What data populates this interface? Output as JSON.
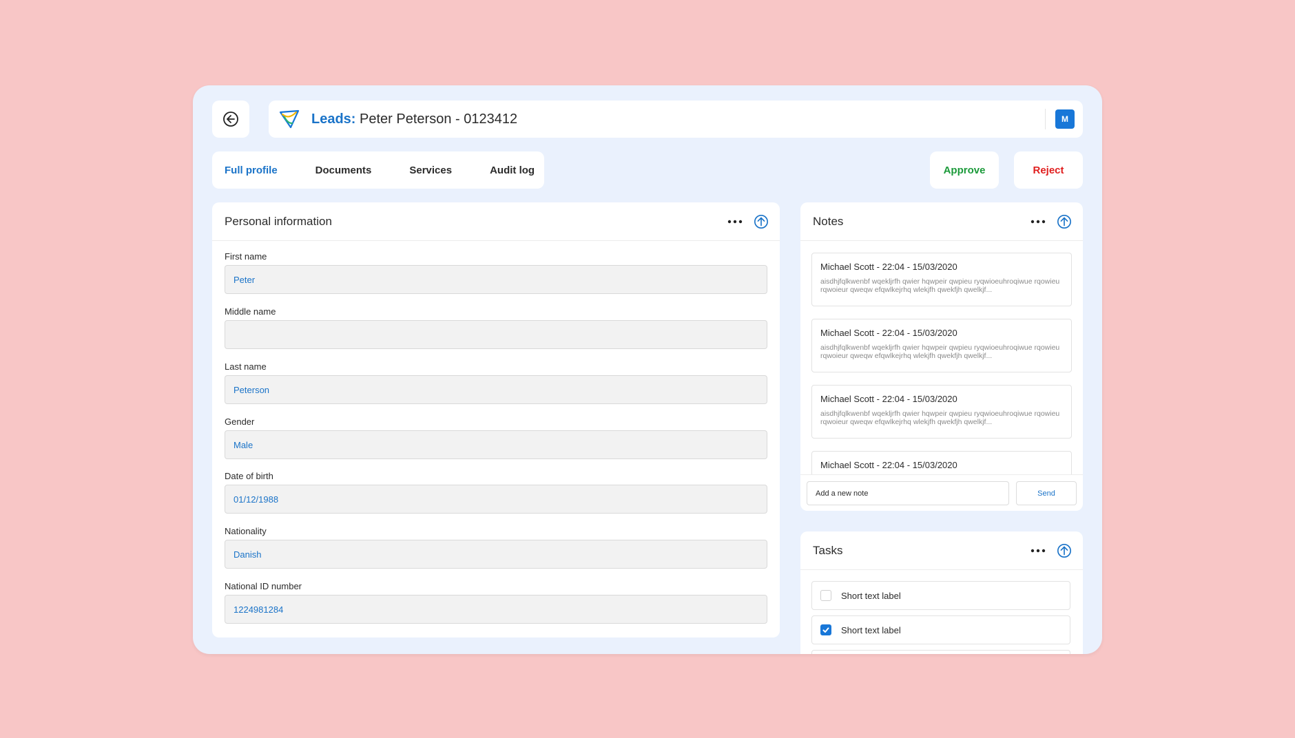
{
  "header": {
    "title_prefix": "Leads:",
    "title": "Peter Peterson - 0123412",
    "avatar_initial": "M"
  },
  "tabs": [
    {
      "label": "Full profile",
      "active": true
    },
    {
      "label": "Documents",
      "active": false
    },
    {
      "label": "Services",
      "active": false
    },
    {
      "label": "Audit log",
      "active": false
    }
  ],
  "actions": {
    "approve_label": "Approve",
    "reject_label": "Reject"
  },
  "personal": {
    "title": "Personal information",
    "fields": [
      {
        "label": "First name",
        "value": "Peter"
      },
      {
        "label": "Middle name",
        "value": ""
      },
      {
        "label": "Last name",
        "value": "Peterson"
      },
      {
        "label": "Gender",
        "value": "Male"
      },
      {
        "label": "Date of birth",
        "value": "01/12/1988"
      },
      {
        "label": "Nationality",
        "value": "Danish"
      },
      {
        "label": "National ID number",
        "value": "1224981284"
      }
    ]
  },
  "notes": {
    "title": "Notes",
    "items": [
      {
        "title": "Michael Scott - 22:04 - 15/03/2020",
        "body": "aisdhjfqlkwenbf wqekljrfh qwier hqwpeir qwpieu ryqwioeuhroqiwue rqowieu rqwoieur qweqw efqwlkejrhq wlekjfh qwekfjh qwelkjf..."
      },
      {
        "title": "Michael Scott - 22:04 - 15/03/2020",
        "body": "aisdhjfqlkwenbf wqekljrfh qwier hqwpeir qwpieu ryqwioeuhroqiwue rqowieu rqwoieur qweqw efqwlkejrhq wlekjfh qwekfjh qwelkjf..."
      },
      {
        "title": "Michael Scott - 22:04 - 15/03/2020",
        "body": "aisdhjfqlkwenbf wqekljrfh qwier hqwpeir qwpieu ryqwioeuhroqiwue rqowieu rqwoieur qweqw efqwlkejrhq wlekjfh qwekfjh qwelkjf..."
      },
      {
        "title": "Michael Scott - 22:04 - 15/03/2020",
        "body": ""
      }
    ],
    "input_placeholder": "Add a new note",
    "send_label": "Send"
  },
  "tasks": {
    "title": "Tasks",
    "items": [
      {
        "label": "Short text label",
        "checked": false
      },
      {
        "label": "Short text label",
        "checked": true
      }
    ]
  },
  "colors": {
    "accent": "#1a73c8",
    "approve": "#1b9a3a",
    "reject": "#e01e1e",
    "background": "#f8c6c6",
    "panel": "#eaf1fd"
  },
  "icons": {
    "back": "arrow-left-circle-icon",
    "logo": "app-logo-icon",
    "more": "more-horizontal-icon",
    "collapse": "arrow-up-circle-icon",
    "check": "check-icon"
  }
}
